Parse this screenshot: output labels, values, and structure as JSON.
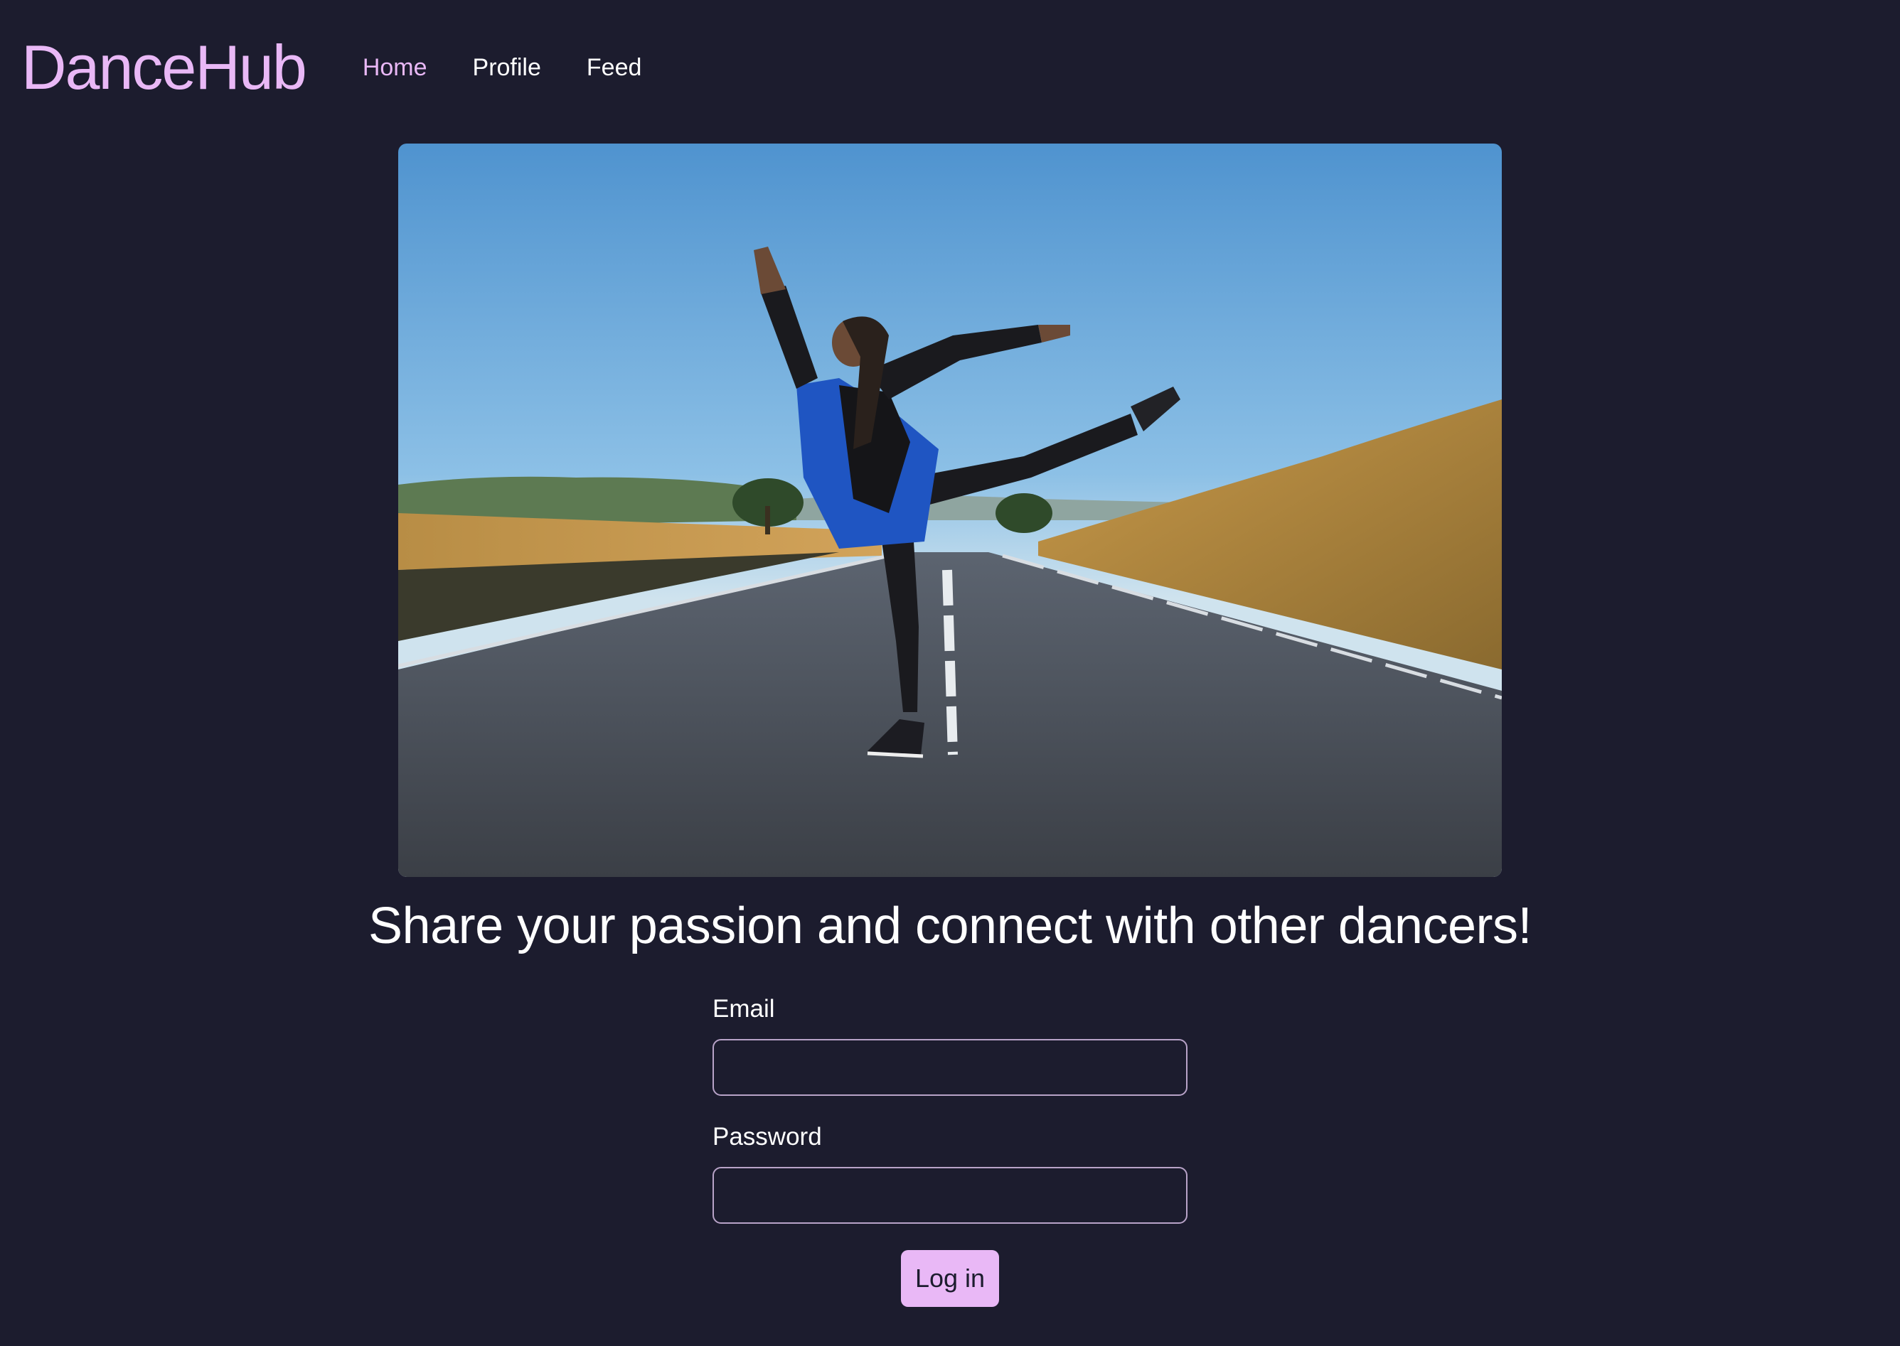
{
  "app": {
    "brand": "DanceHub"
  },
  "nav": {
    "items": [
      {
        "label": "Home",
        "active": true
      },
      {
        "label": "Profile",
        "active": false
      },
      {
        "label": "Feed",
        "active": false
      }
    ]
  },
  "hero": {
    "image_subject": "dancer-on-road-photo"
  },
  "main": {
    "tagline": "Share your passion and connect with other dancers!"
  },
  "login_form": {
    "email_label": "Email",
    "email_value": "",
    "password_label": "Password",
    "password_value": "",
    "submit_label": "Log in"
  },
  "colors": {
    "background": "#1c1c2e",
    "accent": "#e9b8f6",
    "input_border": "#b8a3c8",
    "text": "#ffffff"
  }
}
